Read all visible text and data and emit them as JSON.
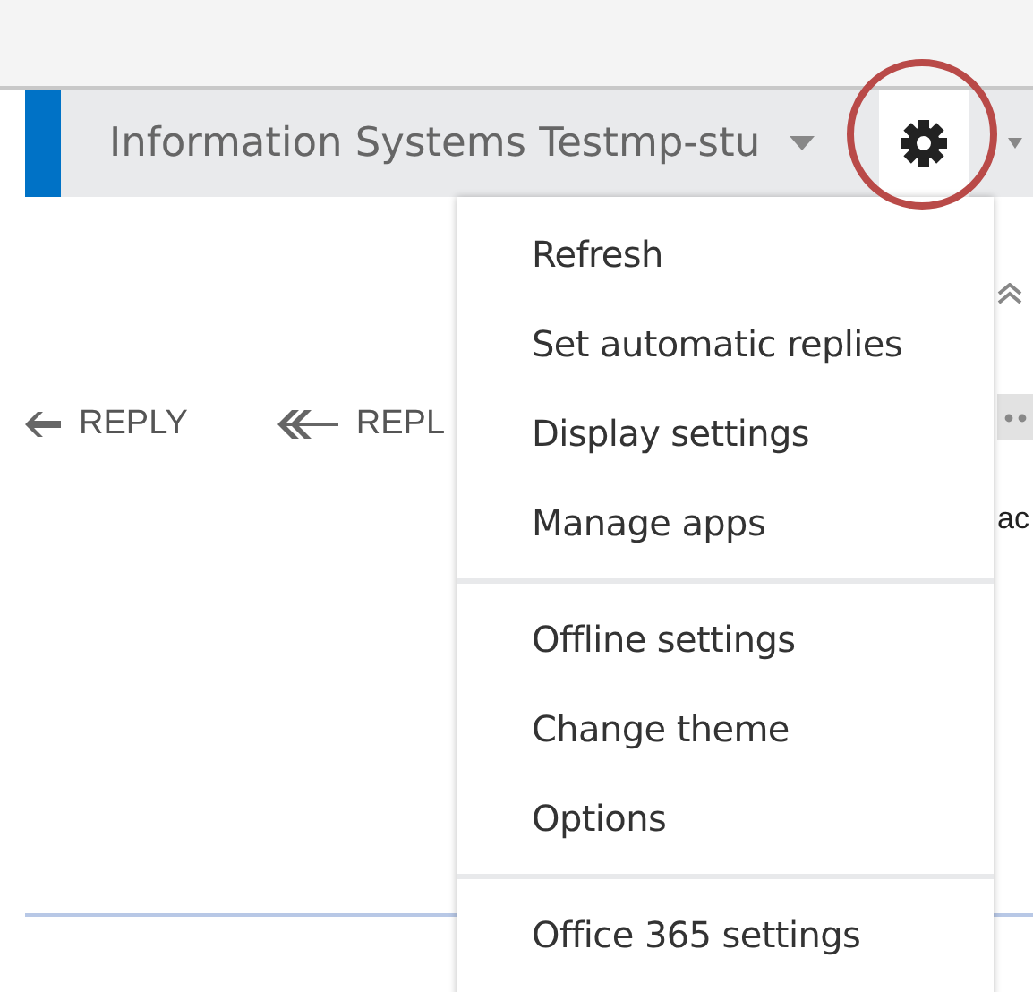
{
  "header": {
    "title": "Information Systems Testmp-stu"
  },
  "toolbar": {
    "reply_buttons": [
      {
        "label": "REPLY",
        "kind": "single"
      },
      {
        "label": "REPL",
        "kind": "all"
      }
    ]
  },
  "reading_pane": {
    "text": "ac"
  },
  "settings_menu": {
    "groups": [
      {
        "items": [
          "Refresh",
          "Set automatic replies",
          "Display settings",
          "Manage apps"
        ]
      },
      {
        "items": [
          "Offline settings",
          "Change theme",
          "Options"
        ]
      },
      {
        "items": [
          "Office 365 settings"
        ]
      }
    ]
  }
}
